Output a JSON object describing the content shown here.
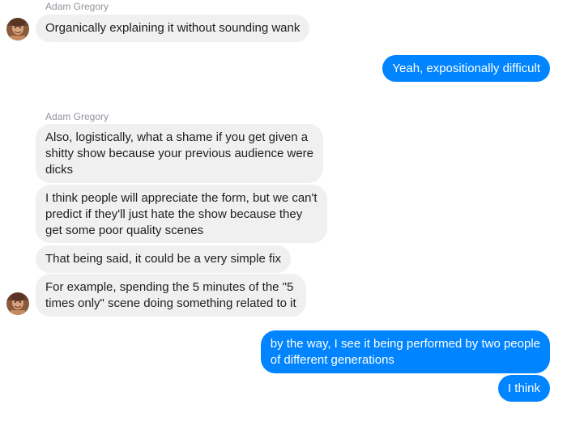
{
  "thread": {
    "group1": {
      "sender": "Adam Gregory",
      "messages": [
        "Organically explaining it without sounding wank"
      ]
    },
    "out1": [
      "Yeah, expositionally difficult"
    ],
    "group2": {
      "sender": "Adam Gregory",
      "messages": [
        [
          "Also, logistically, what a shame if you get given a",
          "shitty show because your previous audience were",
          "dicks"
        ],
        [
          "I think people will appreciate the form, but we can't",
          "predict if they'll just hate the show because they",
          "get some poor quality scenes"
        ],
        [
          "That being said, it could be a very simple fix"
        ],
        [
          "For example, spending the 5 minutes of the \"5",
          "times only\" scene doing something related to it"
        ]
      ]
    },
    "out2": [
      [
        "by the way, I see it being performed by two people",
        "of different generations"
      ],
      [
        "I think"
      ]
    ]
  },
  "colors": {
    "incoming_bubble": "#f1f0f0",
    "outgoing_bubble": "#0084ff",
    "sender_name": "#90949c"
  },
  "icons": {
    "avatar": "user-avatar-photo"
  }
}
